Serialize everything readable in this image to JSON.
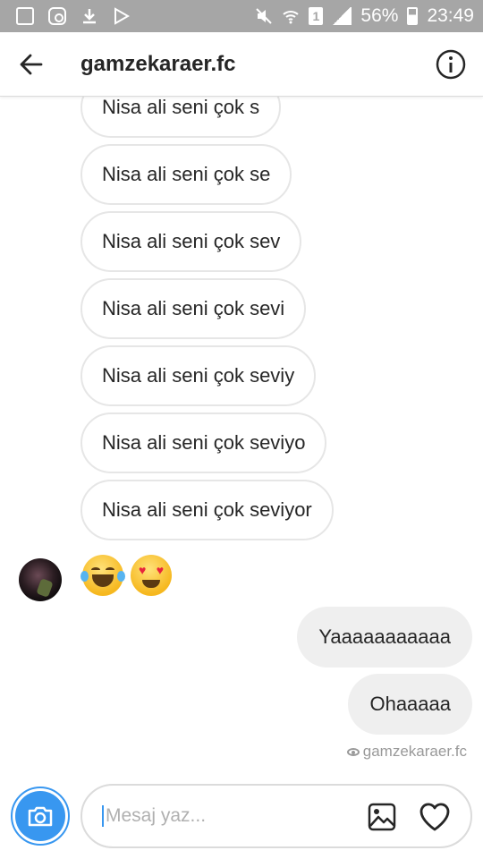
{
  "status_bar": {
    "battery_percent": "56%",
    "time": "23:49",
    "sim_label": "1",
    "left_icons": [
      "gallery-icon",
      "instagram-icon",
      "download-icon",
      "play-store-icon"
    ],
    "right_icons": [
      "mute-icon",
      "wifi-icon",
      "sim-icon",
      "signal-icon",
      "battery-icon"
    ]
  },
  "header": {
    "username": "gamzekaraer.fc",
    "back_icon": "arrow-left-icon",
    "info_icon": "info-icon"
  },
  "messages": {
    "incoming": [
      "Nisa ali seni çok s",
      "Nisa ali seni çok se",
      "Nisa ali seni çok sev",
      "Nisa ali seni çok sevi",
      "Nisa ali seni çok seviy",
      "Nisa ali seni çok seviyo",
      "Nisa ali seni çok seviyor"
    ],
    "emoji_reply": [
      "face-with-tears-of-joy",
      "heart-eyes"
    ],
    "outgoing": [
      "Yaaaaaaaaaaa",
      "Ohaaaaa"
    ],
    "seen_by": "gamzekaraer.fc"
  },
  "composer": {
    "placeholder": "Mesaj yaz...",
    "value": "",
    "camera_icon": "camera-icon",
    "gallery_icon": "image-icon",
    "like_icon": "heart-icon",
    "accent": "#3897f0"
  }
}
